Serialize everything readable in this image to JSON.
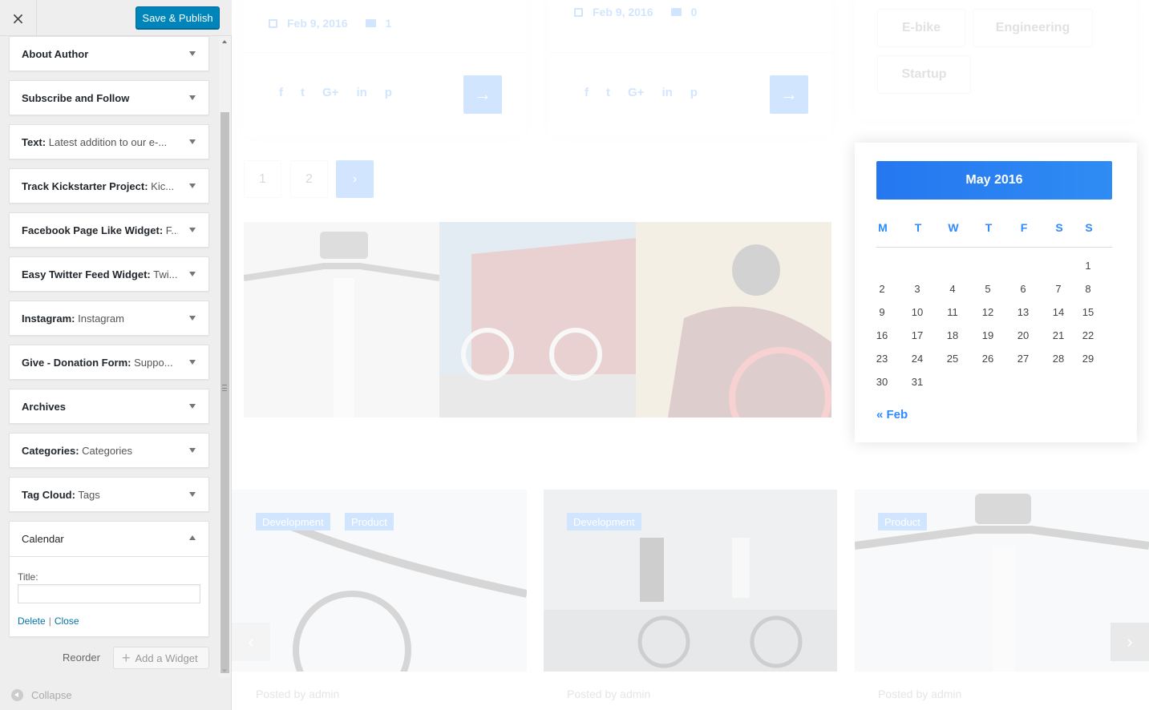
{
  "header": {
    "close_label": "×",
    "save_label": "Save & Publish"
  },
  "widgets": [
    {
      "name": "About Author",
      "sub": ""
    },
    {
      "name": "Subscribe and Follow",
      "sub": ""
    },
    {
      "name": "Text",
      "sub": "Latest addition to our e-..."
    },
    {
      "name": "Track Kickstarter Project",
      "sub": "Kic..."
    },
    {
      "name": "Facebook Page Like Widget",
      "sub": "F..."
    },
    {
      "name": "Easy Twitter Feed Widget",
      "sub": "Twi..."
    },
    {
      "name": "Instagram",
      "sub": "Instagram"
    },
    {
      "name": "Give - Donation Form",
      "sub": "Suppo..."
    },
    {
      "name": "Archives",
      "sub": ""
    },
    {
      "name": "Categories",
      "sub": "Categories"
    },
    {
      "name": "Tag Cloud",
      "sub": "Tags"
    },
    {
      "name": "Calendar",
      "sub": ""
    }
  ],
  "calendar_widget_form": {
    "title_label": "Title:",
    "title_value": "",
    "delete_label": "Delete",
    "close_label": "Close"
  },
  "footer": {
    "reorder_label": "Reorder",
    "add_widget_label": "Add a Widget",
    "collapse_label": "Collapse"
  },
  "preview": {
    "posts_top": [
      {
        "date": "Feb 9, 2016",
        "comments": "1"
      },
      {
        "date": "Feb 9, 2016",
        "comments": "0"
      }
    ],
    "social_icons": [
      "f",
      "t",
      "G+",
      "in",
      "p"
    ],
    "go_arrow": "→",
    "pagination": [
      "1",
      "2",
      "›"
    ],
    "tags": [
      "E-bike",
      "Engineering",
      "Startup"
    ],
    "bottom_posts": [
      {
        "categories": [
          "Development",
          "Product"
        ],
        "posted": "Posted by admin"
      },
      {
        "categories": [
          "Development"
        ],
        "posted": "Posted by admin"
      },
      {
        "categories": [
          "Product"
        ],
        "posted": "Posted by admin"
      }
    ],
    "slider_prev": "‹",
    "slider_next": "›",
    "calendar": {
      "month": "May 2016",
      "weekdays": [
        "M",
        "T",
        "W",
        "T",
        "F",
        "S",
        "S"
      ],
      "first_weekday_index": 6,
      "days_in_month": 31,
      "prev_link": "« Feb"
    }
  },
  "colors": {
    "accent": "#2e8bff",
    "button_primary": "#0085ba",
    "sidebar_bg": "#eeeeee"
  }
}
